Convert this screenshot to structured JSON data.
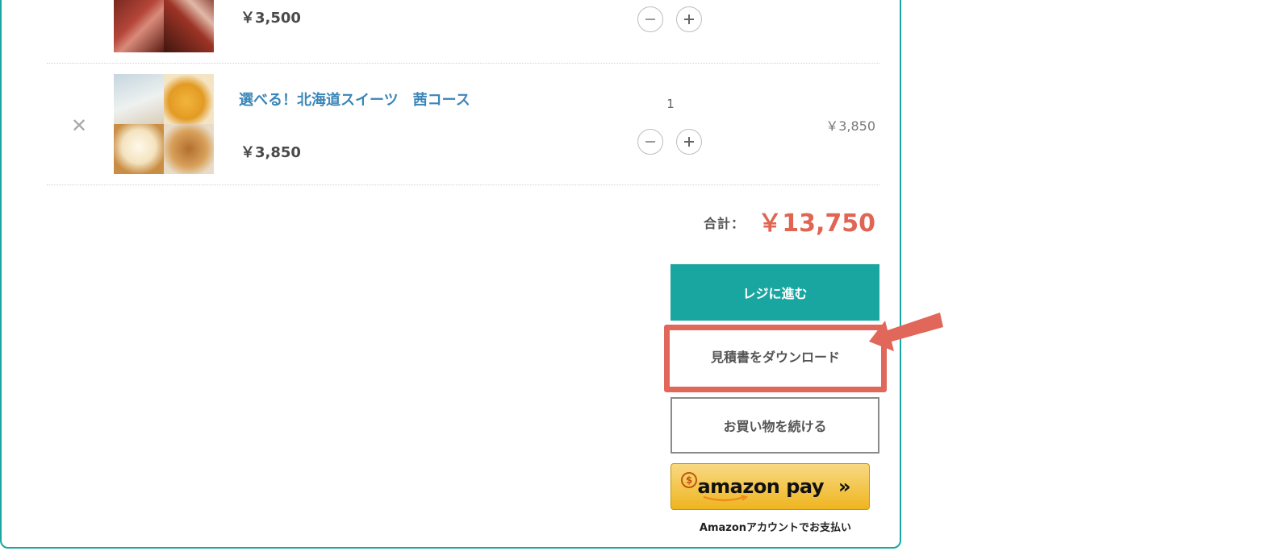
{
  "cart": {
    "items": [
      {
        "name": "",
        "unit_price": "￥3,500"
      },
      {
        "name": "選べる！北海道スイーツ　茜コース",
        "unit_price": "￥3,850",
        "quantity": "1",
        "line_total": "￥3,850"
      }
    ],
    "total_label": "合計：",
    "total_value": "￥13,750"
  },
  "actions": {
    "checkout_label": "レジに進む",
    "quote_label": "見積書をダウンロード",
    "continue_label": "お買い物を続ける",
    "amazon_logo": "amazon pay",
    "amazon_chevrons": "»",
    "amazon_caption": "Amazonアカウントでお支払い"
  },
  "annotation": {
    "target": "quote-download-button",
    "color": "#e0675a"
  },
  "theme": {
    "accent": "#1aa6a0",
    "price_red": "#e06552",
    "link_blue": "#3b86b8"
  }
}
